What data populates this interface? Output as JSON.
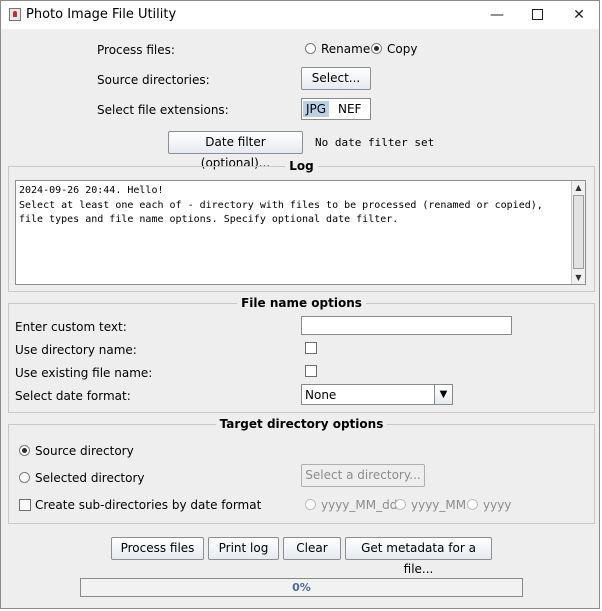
{
  "window": {
    "title": "Photo Image File Utility"
  },
  "top": {
    "process_files_label": "Process files:",
    "rename_label": "Rename",
    "copy_label": "Copy",
    "selected_mode": "Copy",
    "source_dirs_label": "Source directories:",
    "select_button": "Select...",
    "extensions_label": "Select file extensions:",
    "extensions": [
      "JPG",
      "NEF"
    ],
    "selected_extension": "JPG",
    "date_filter_button": "Date filter (optional)...",
    "date_filter_status": "No date filter set"
  },
  "log": {
    "legend": "Log",
    "lines": [
      "2024-09-26 20:44. Hello!",
      "Select at least one each of - directory with files to be processed (renamed or copied),",
      "file types and file name options. Specify optional date filter."
    ]
  },
  "file_name_options": {
    "legend": "File name options",
    "custom_text_label": "Enter custom text:",
    "custom_text_value": "",
    "use_dir_name_label": "Use directory name:",
    "use_dir_name_checked": false,
    "use_existing_name_label": "Use existing file name:",
    "use_existing_name_checked": false,
    "date_format_label": "Select date format:",
    "date_format_value": "None"
  },
  "target_options": {
    "legend": "Target directory options",
    "source_dir_label": "Source directory",
    "selected_dir_label": "Selected directory",
    "selected_target": "Source directory",
    "select_dir_button": "Select a directory...",
    "create_subdirs_label": "Create sub-directories by date format",
    "create_subdirs_checked": false,
    "formats": [
      "yyyy_MM_dd",
      "yyyy_MM",
      "yyyy"
    ]
  },
  "actions": {
    "process_files": "Process files",
    "print_log": "Print log",
    "clear": "Clear",
    "get_metadata": "Get metadata for a file..."
  },
  "progress": {
    "value": 0,
    "label": "0%"
  }
}
